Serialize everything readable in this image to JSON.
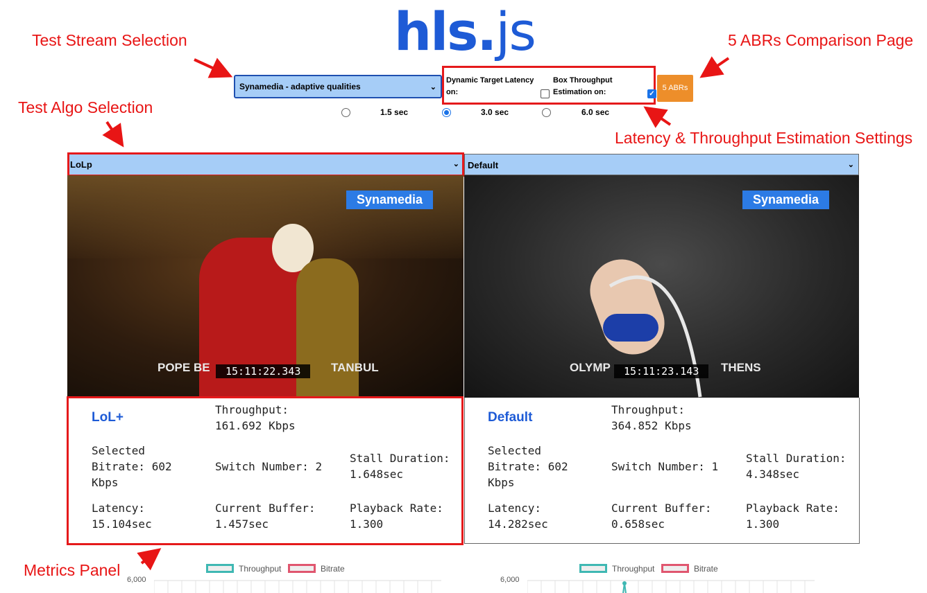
{
  "logo": {
    "main": "hls",
    "dot": ".",
    "suffix": "js"
  },
  "annotations": {
    "stream": "Test Stream Selection",
    "abr": "5 ABRs Comparison Page",
    "algo": "Test Algo Selection",
    "latency": "Latency & Throughput Estimation Settings",
    "metrics": "Metrics Panel"
  },
  "controls": {
    "stream_value": "Synamedia - adaptive qualities",
    "dynamic_latency_label": "Dynamic Target Latency\non:",
    "dynamic_latency_checked": false,
    "box_throughput_label": "Box Throughput\nEstimation on:",
    "box_throughput_checked": true,
    "abr_button": "5 ABRs",
    "latency_options": [
      {
        "label": "1.5 sec",
        "checked": false
      },
      {
        "label": "3.0 sec",
        "checked": true
      },
      {
        "label": "6.0 sec",
        "checked": false
      }
    ]
  },
  "players": [
    {
      "algo_select": "LoLp",
      "brand": "Synamedia",
      "timestamp": "15:11:22.343",
      "caption": "POPE BE",
      "caption2": "TANBUL",
      "algo_name": "LoL+",
      "throughput": "Throughput:\n161.692 Kbps",
      "bitrate": "Selected\nBitrate: 602\nKbps",
      "switches": "Switch Number: 2",
      "stall": "Stall Duration:\n1.648sec",
      "latency": "Latency:\n15.104sec",
      "buffer": "Current Buffer:\n1.457sec",
      "rate": "Playback Rate:\n1.300"
    },
    {
      "algo_select": "Default",
      "brand": "Synamedia",
      "timestamp": "15:11:23.143",
      "caption": "OLYMP",
      "caption2": "THENS",
      "algo_name": "Default",
      "throughput": "Throughput:\n364.852 Kbps",
      "bitrate": "Selected\nBitrate: 602\nKbps",
      "switches": "Switch Number: 1",
      "stall": "Stall Duration:\n4.348sec",
      "latency": "Latency:\n14.282sec",
      "buffer": "Current Buffer:\n0.658sec",
      "rate": "Playback Rate:\n1.300"
    }
  ],
  "charts": {
    "legend_throughput": "Throughput",
    "legend_bitrate": "Bitrate",
    "throughput_color": "#3fb8b3",
    "bitrate_color": "#e0566f",
    "ytick_top": "6,000"
  }
}
